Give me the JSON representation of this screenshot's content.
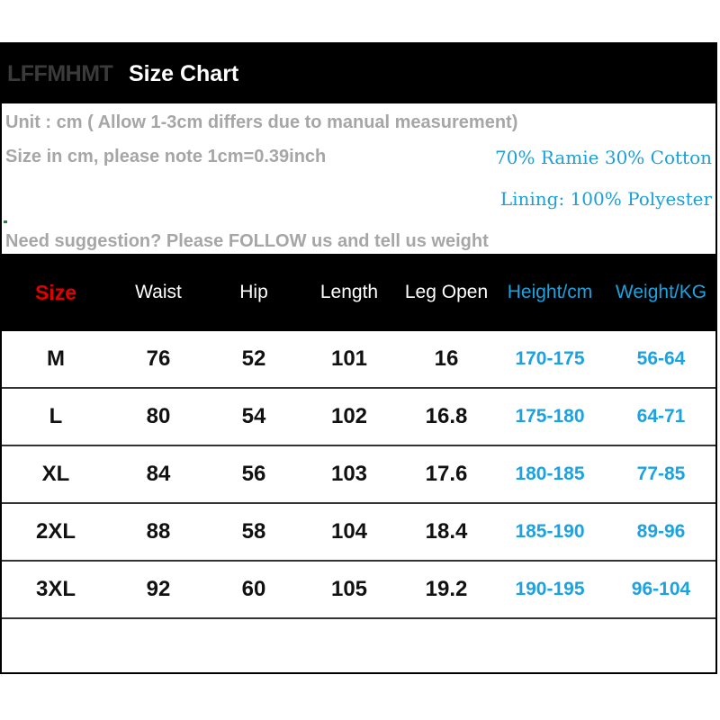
{
  "title_bar": {
    "brand": "LFFMHMT",
    "title": "Size Chart"
  },
  "notes": {
    "unit": "Unit : cm ( Allow 1-3cm differs due to manual measurement)",
    "conversion": "Size in cm, please note 1cm=0.39inch",
    "suggestion": "Need suggestion? Please FOLLOW us and tell us weight"
  },
  "fabric": {
    "material": "70% Ramie 30% Cotton",
    "lining": "Lining: 100% Polyester"
  },
  "table": {
    "headers": [
      "Size",
      "Waist",
      "Hip",
      "Length",
      "Leg Open",
      "Height/cm",
      "Weight/KG"
    ],
    "rows": [
      [
        "M",
        "76",
        "52",
        "101",
        "16",
        "170-175",
        "56-64"
      ],
      [
        "L",
        "80",
        "54",
        "102",
        "16.8",
        "175-180",
        "64-71"
      ],
      [
        "XL",
        "84",
        "56",
        "103",
        "17.6",
        "180-185",
        "77-85"
      ],
      [
        "2XL",
        "88",
        "58",
        "104",
        "18.4",
        "185-190",
        "89-96"
      ],
      [
        "3XL",
        "92",
        "60",
        "105",
        "19.2",
        "190-195",
        "96-104"
      ]
    ]
  },
  "colors": {
    "size_header": "#e00000",
    "accent_blue": "#1aa3e0",
    "note_gray": "#a6a6a6"
  }
}
